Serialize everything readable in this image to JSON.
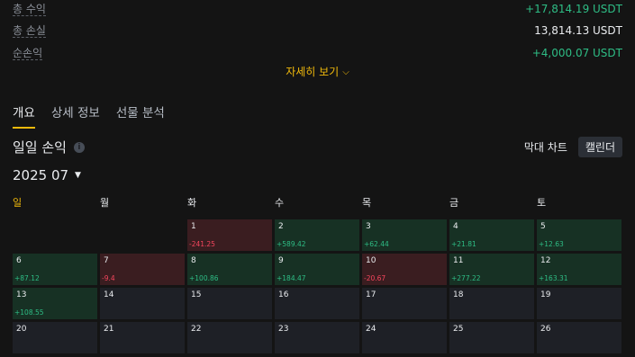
{
  "summary": [
    {
      "label": "총 수익",
      "value": "+17,814.19 USDT",
      "tone": "pos"
    },
    {
      "label": "총 손실",
      "value": "13,814.13 USDT",
      "tone": "white"
    },
    {
      "label": "순손익",
      "value": "+4,000.07 USDT",
      "tone": "pos"
    }
  ],
  "detail_link": "자세히 보기",
  "tabs": [
    {
      "label": "개요",
      "active": true
    },
    {
      "label": "상세 정보",
      "active": false
    },
    {
      "label": "선물 분석",
      "active": false
    }
  ],
  "section_title": "일일 손익",
  "view_toggle": {
    "bar": "막대 차트",
    "calendar": "캘린더",
    "active": "calendar"
  },
  "month": "2025 07",
  "weekdays": [
    "일",
    "월",
    "화",
    "수",
    "목",
    "금",
    "토"
  ],
  "calendar": [
    {
      "day": "",
      "pnl": "",
      "tone": "empty"
    },
    {
      "day": "",
      "pnl": "",
      "tone": "empty"
    },
    {
      "day": "1",
      "pnl": "-241.25",
      "tone": "loss"
    },
    {
      "day": "2",
      "pnl": "+589.42",
      "tone": "profit"
    },
    {
      "day": "3",
      "pnl": "+62.44",
      "tone": "profit"
    },
    {
      "day": "4",
      "pnl": "+21.81",
      "tone": "profit"
    },
    {
      "day": "5",
      "pnl": "+12.63",
      "tone": "profit"
    },
    {
      "day": "6",
      "pnl": "+87.12",
      "tone": "profit"
    },
    {
      "day": "7",
      "pnl": "-9.4",
      "tone": "loss"
    },
    {
      "day": "8",
      "pnl": "+100.86",
      "tone": "profit"
    },
    {
      "day": "9",
      "pnl": "+184.47",
      "tone": "profit"
    },
    {
      "day": "10",
      "pnl": "-20.67",
      "tone": "loss"
    },
    {
      "day": "11",
      "pnl": "+277.22",
      "tone": "profit"
    },
    {
      "day": "12",
      "pnl": "+163.31",
      "tone": "profit"
    },
    {
      "day": "13",
      "pnl": "+108.55",
      "tone": "profit"
    },
    {
      "day": "14",
      "pnl": "",
      "tone": "none"
    },
    {
      "day": "15",
      "pnl": "",
      "tone": "none"
    },
    {
      "day": "16",
      "pnl": "",
      "tone": "none"
    },
    {
      "day": "17",
      "pnl": "",
      "tone": "none"
    },
    {
      "day": "18",
      "pnl": "",
      "tone": "none"
    },
    {
      "day": "19",
      "pnl": "",
      "tone": "none"
    },
    {
      "day": "20",
      "pnl": "",
      "tone": "none"
    },
    {
      "day": "21",
      "pnl": "",
      "tone": "none"
    },
    {
      "day": "22",
      "pnl": "",
      "tone": "none"
    },
    {
      "day": "23",
      "pnl": "",
      "tone": "none"
    },
    {
      "day": "24",
      "pnl": "",
      "tone": "none"
    },
    {
      "day": "25",
      "pnl": "",
      "tone": "none"
    },
    {
      "day": "26",
      "pnl": "",
      "tone": "none"
    }
  ],
  "icons": {
    "detail": "chevron-down-icon",
    "info": "info-icon",
    "month": "caret-down-icon"
  },
  "colors": {
    "profit": "#2ebd85",
    "loss": "#f6465d",
    "accent": "#f0b90b",
    "background": "#141414"
  }
}
